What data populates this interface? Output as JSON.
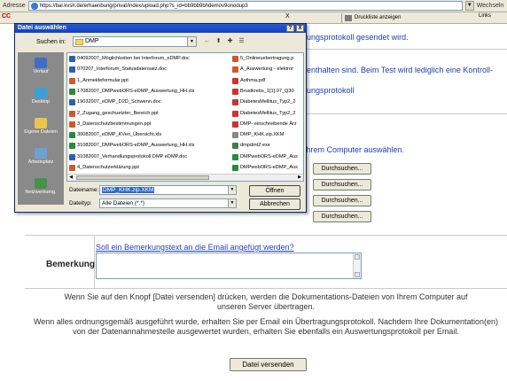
{
  "browser": {
    "address_label": "Adresse",
    "url": "https://bal.kvsh.de/erhaenbung/privat/index/upload.php?s_id=bb9bb9bhdemov9onodup3",
    "go_label": "Wechseln",
    "tab_left": "CC",
    "tab_close": "X",
    "print_label": "Druckliste anzeigen",
    "links_label": "Links"
  },
  "page": {
    "text_protocol": "ungsprotokoll gesendet wird.",
    "text_contained": "enthalten sind. Beim Test wird lediglich eine Kontroll-",
    "text_protocol2": "ungsprotokoll",
    "text_choose": "Ihrem Computer auswählen.",
    "browse_label": "Durchsuchen...",
    "remark_prompt": "Soll ein Bemerkungstext an die Email angefügt werden?",
    "remark_label": "Bemerkung",
    "info1": "Wenn Sie auf den Knopf [Datei versenden] drücken, werden die Dokumentations-Dateien von Ihrem Computer auf unseren Server übertragen.",
    "info2": "Wenn alles ordnungsgemäß ausgeführt wurde, erhalten Sie per Email ein Übertragungsprotokoll. Nachdem Ihre Dokumentation(en) von der Datenannahmestelle ausgewertet wurden, erhalten Sie ebenfalls ein Auswertungsprotokoll per Email.",
    "send_label": "Datei versenden"
  },
  "dialog": {
    "title": "Datei auswählen",
    "help_btn": "?",
    "close_btn": "X",
    "look_in_label": "Suchen in:",
    "look_in_value": "DMP",
    "places": [
      {
        "label": "Verlauf",
        "color": "#3d6fc4"
      },
      {
        "label": "Desktop",
        "color": "#3aa0d8"
      },
      {
        "label": "Eigene Dateien",
        "color": "#e8c64a"
      },
      {
        "label": "Arbeitsplatz",
        "color": "#6fa0d0"
      },
      {
        "label": "Netzwerkumg.",
        "color": "#4a8f4a"
      }
    ],
    "files_col1": [
      {
        "name": "04092007_Möglichkeiten bei Interforum_eDMP.doc",
        "color": "#2b5fb6"
      },
      {
        "name": "070207_Interforum_Statusdatensatz.doc",
        "color": "#2b5fb6"
      },
      {
        "name": "1_Anmeldeformular.ppt",
        "color": "#d2582a"
      },
      {
        "name": "17082007_DMPwebORS-eDMP_Auswertung_HH.xls",
        "color": "#2a8a3a"
      },
      {
        "name": "19032007_eDMP_D2D_Schwenn.doc",
        "color": "#2b5fb6"
      },
      {
        "name": "2_Zugang_geschuetzter_Bereich.ppt",
        "color": "#d2582a"
      },
      {
        "name": "3_Datenschutzbestimmungen.ppt",
        "color": "#d2582a"
      },
      {
        "name": "30082007_eDMP_KVen_Übersicht.xls",
        "color": "#2a8a3a"
      },
      {
        "name": "31082007_DMPwebORS-eDMP_Auswertung_HH.xls",
        "color": "#2a8a3a"
      },
      {
        "name": "31082007_Verhandlungsprotokoll DMP eDMP.doc",
        "color": "#2b5fb6"
      },
      {
        "name": "4_Datenschutzerklärung.ppt",
        "color": "#d2582a"
      }
    ],
    "files_col2": [
      {
        "name": "5_Onlineuebertragung.p",
        "color": "#d2582a"
      },
      {
        "name": "A_Auswertung - elektror",
        "color": "#d2582a"
      },
      {
        "name": "Asthma.pdf",
        "color": "#c33"
      },
      {
        "name": "Brustkrebs_1[1].07_Q30",
        "color": "#c33"
      },
      {
        "name": "DiabetesMellitus_Typ2_2",
        "color": "#c33"
      },
      {
        "name": "DiabetesMellitus_Typ2_2",
        "color": "#c33"
      },
      {
        "name": "DMP- einschreibende Ärz",
        "color": "#c33"
      },
      {
        "name": "DMP_KHK.zip.XKM",
        "color": "#888"
      },
      {
        "name": "dmpdmt2.exe",
        "color": "#4a7a4a"
      },
      {
        "name": "DMPwebORS-eDMP_Aus",
        "color": "#2a8a3a"
      },
      {
        "name": "DMPwebORS-eDMP_Aus",
        "color": "#2a8a3a"
      }
    ],
    "filename_label": "Dateiname:",
    "filename_value": "DMP_KHK.zip.XKM",
    "filetype_label": "Dateityp:",
    "filetype_value": "Alle Dateien (*.*)",
    "open_label": "Öffnen",
    "cancel_label": "Abbrechen"
  }
}
